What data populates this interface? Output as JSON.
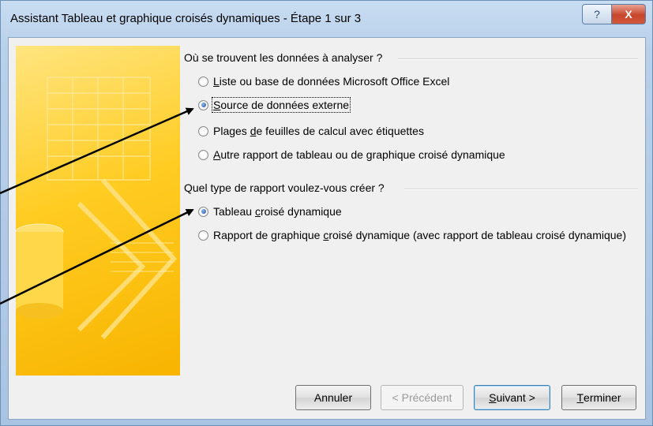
{
  "window": {
    "title": "Assistant Tableau et graphique croisés dynamiques - Étape 1 sur 3",
    "help_glyph": "?",
    "close_glyph": "X"
  },
  "source_group": {
    "title": "Où se trouvent les données à analyser ?",
    "options": [
      {
        "key": "L",
        "rest": "iste ou base de données Microsoft Office Excel",
        "checked": false
      },
      {
        "key": "S",
        "rest": "ource de données externe",
        "checked": true
      },
      {
        "pre": "Plages ",
        "key": "d",
        "rest": "e feuilles de calcul avec étiquettes",
        "checked": false
      },
      {
        "key": "A",
        "rest": "utre rapport de tableau ou de graphique croisé dynamique",
        "checked": false
      }
    ]
  },
  "report_group": {
    "title": "Quel type de rapport voulez-vous créer ?",
    "options": [
      {
        "pre": "Tableau ",
        "key": "c",
        "rest": "roisé dynamique",
        "checked": true
      },
      {
        "pre": "Rapport de graphique ",
        "key": "c",
        "rest": "roisé dynamique (avec rapport de tableau croisé dynamique)",
        "checked": false
      }
    ]
  },
  "buttons": {
    "cancel": "Annuler",
    "back": "< Précédent",
    "next_key": "S",
    "next_rest": "uivant >",
    "finish_key": "T",
    "finish_rest": "erminer"
  },
  "colors": {
    "title_bar": "#b8d0ea",
    "close_button": "#c8452a",
    "side_panel": "#ffcc22",
    "annotation_arrows": "#000000"
  }
}
